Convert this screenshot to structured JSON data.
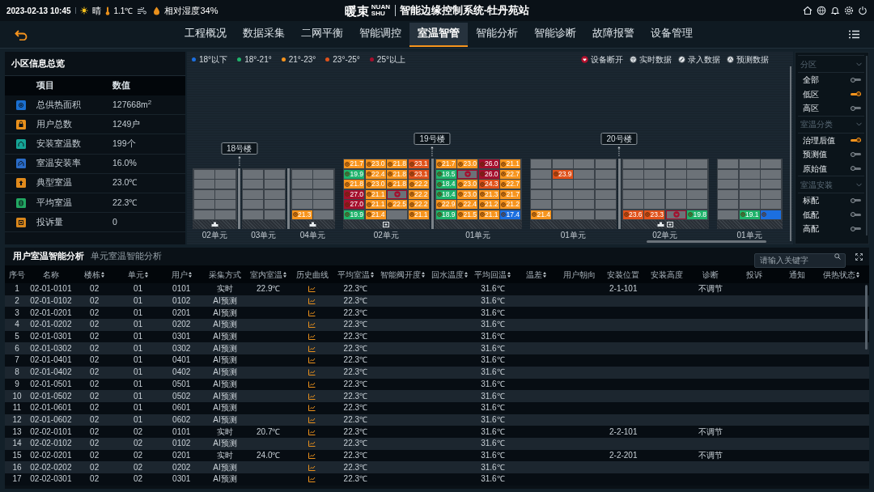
{
  "header": {
    "date_time": "2023-02-13 10:45",
    "weather": "晴",
    "temperature": "1.1℃",
    "humidity": "相对湿度34%",
    "logo": "暖束",
    "logo_sub": "NUAN SHU",
    "title": "智能边缘控制系统-牡丹苑站"
  },
  "nav": [
    {
      "label": "工程概况",
      "selected": false
    },
    {
      "label": "数据采集",
      "selected": false
    },
    {
      "label": "二网平衡",
      "selected": false
    },
    {
      "label": "智能调控",
      "selected": false
    },
    {
      "label": "室温智管",
      "selected": true
    },
    {
      "label": "智能分析",
      "selected": false
    },
    {
      "label": "智能诊断",
      "selected": false
    },
    {
      "label": "故障报警",
      "selected": false
    },
    {
      "label": "设备管理",
      "selected": false
    }
  ],
  "overview": {
    "title": "小区信息总览",
    "columns": [
      "项目",
      "数值"
    ],
    "rows": [
      {
        "label": "总供热面积",
        "value": "127668m$^{2}$",
        "color": "#1a6fd0"
      },
      {
        "label": "用户总数",
        "value": "1249户",
        "color": "#e8901c"
      },
      {
        "label": "安装室温数",
        "value": "199个",
        "color": "#16a596"
      },
      {
        "label": "室温安装率",
        "value": "16.0%",
        "color": "#2a6cc8"
      },
      {
        "label": "典型室温",
        "value": "23.0℃",
        "color": "#e08a1c"
      },
      {
        "label": "平均室温",
        "value": "22.3℃",
        "color": "#22a862"
      },
      {
        "label": "投诉量",
        "value": "0",
        "color": "#d8861c"
      }
    ]
  },
  "legend": {
    "temperature": [
      {
        "label": "18°以下",
        "color": "#1c6fe0"
      },
      {
        "label": "18°-21°",
        "color": "#1fb36b"
      },
      {
        "label": "21°-23°",
        "color": "#f7941d"
      },
      {
        "label": "23°-25°",
        "color": "#e0521b"
      },
      {
        "label": "25°以上",
        "color": "#a50f2d"
      }
    ],
    "data_source": [
      {
        "label": "设备断开",
        "kind": "offline"
      },
      {
        "label": "实时数据",
        "kind": "realtime"
      },
      {
        "label": "录入数据",
        "kind": "input"
      },
      {
        "label": "预测数据",
        "kind": "predicted"
      }
    ]
  },
  "buildings": [
    {
      "name": "18号楼",
      "units": [
        {
          "label": "02单元",
          "devices": [
            {
              "kind": "valve"
            }
          ],
          "rows": [
            [
              {
                "kind": "vacant"
              },
              {
                "kind": "vacant"
              }
            ],
            [
              {
                "kind": "vacant"
              },
              {
                "kind": "vacant"
              }
            ],
            [
              {
                "kind": "vacant"
              },
              {
                "kind": "vacant"
              }
            ],
            [
              {
                "kind": "vacant"
              },
              {
                "kind": "vacant"
              }
            ],
            [
              {
                "kind": "vacant"
              },
              {
                "kind": "vacant"
              }
            ]
          ]
        },
        {
          "label": "03单元",
          "rows": [
            [
              {
                "kind": "vacant"
              },
              {
                "kind": "vacant"
              }
            ],
            [
              {
                "kind": "vacant"
              },
              {
                "kind": "vacant"
              }
            ],
            [
              {
                "kind": "vacant"
              },
              {
                "kind": "vacant"
              }
            ],
            [
              {
                "kind": "vacant"
              },
              {
                "kind": "vacant"
              }
            ],
            [
              {
                "kind": "vacant"
              },
              {
                "kind": "vacant"
              }
            ]
          ]
        },
        {
          "label": "04单元",
          "devices": [
            {
              "kind": "valve"
            }
          ],
          "rows": [
            [
              {
                "kind": "vacant"
              },
              {
                "kind": "vacant"
              }
            ],
            [
              {
                "kind": "vacant"
              },
              {
                "kind": "vacant"
              }
            ],
            [
              {
                "kind": "vacant"
              },
              {
                "kind": "vacant"
              }
            ],
            [
              {
                "kind": "vacant"
              },
              {
                "kind": "vacant"
              }
            ],
            [
              {
                "kind": "realtime",
                "temp": "21.3",
                "color": "#f7941d"
              },
              {
                "kind": "vacant"
              }
            ]
          ]
        }
      ]
    },
    {
      "name": "19号楼",
      "units": [
        {
          "label": "02单元",
          "devices": [
            {
              "kind": "meter"
            }
          ],
          "rows": [
            [
              {
                "kind": "realtime",
                "temp": "21.7",
                "color": "#f7941d"
              },
              {
                "kind": "predicted",
                "temp": "23.0",
                "color": "#f7941d"
              },
              {
                "kind": "realtime",
                "temp": "21.8",
                "color": "#f7941d"
              },
              {
                "kind": "realtime",
                "temp": "23.1",
                "color": "#e0521b"
              }
            ],
            [
              {
                "kind": "realtime",
                "temp": "19.9",
                "color": "#1fb36b"
              },
              {
                "kind": "realtime",
                "temp": "22.4",
                "color": "#f7941d"
              },
              {
                "kind": "predicted",
                "temp": "21.8",
                "color": "#f7941d"
              },
              {
                "kind": "predicted",
                "temp": "23.1",
                "color": "#e0521b"
              }
            ],
            [
              {
                "kind": "realtime",
                "temp": "21.8",
                "color": "#f7941d"
              },
              {
                "kind": "realtime",
                "temp": "23.0",
                "color": "#f7941d"
              },
              {
                "kind": "predicted",
                "temp": "21.8",
                "color": "#f7941d"
              },
              {
                "kind": "realtime",
                "temp": "22.2",
                "color": "#f7941d"
              }
            ],
            [
              {
                "kind": "realtime",
                "temp": "27.0",
                "color": "#a50f2d"
              },
              {
                "kind": "realtime",
                "temp": "21.1",
                "color": "#f7941d"
              },
              {
                "kind": "offline",
                "color": "#a50f2d"
              },
              {
                "kind": "predicted",
                "temp": "22.2",
                "color": "#f7941d"
              }
            ],
            [
              {
                "kind": "realtime",
                "temp": "27.0",
                "color": "#a50f2d"
              },
              {
                "kind": "realtime",
                "temp": "21.1",
                "color": "#f7941d"
              },
              {
                "kind": "realtime",
                "temp": "22.5",
                "color": "#f7941d"
              },
              {
                "kind": "realtime",
                "temp": "22.2",
                "color": "#f7941d"
              }
            ],
            [
              {
                "kind": "realtime",
                "temp": "19.9",
                "color": "#1fb36b"
              },
              {
                "kind": "realtime",
                "temp": "21.4",
                "color": "#f7941d"
              },
              {
                "kind": "vacant"
              },
              {
                "kind": "predicted",
                "temp": "21.1",
                "color": "#f7941d"
              }
            ]
          ]
        },
        {
          "label": "01单元",
          "rows": [
            [
              {
                "kind": "realtime",
                "temp": "21.7",
                "color": "#f7941d"
              },
              {
                "kind": "predicted",
                "temp": "23.0",
                "color": "#f7941d"
              },
              {
                "kind": "realtime",
                "temp": "26.0",
                "color": "#a50f2d"
              },
              {
                "kind": "realtime",
                "temp": "21.1",
                "color": "#f7941d"
              }
            ],
            [
              {
                "kind": "realtime",
                "temp": "18.5",
                "color": "#1fb36b"
              },
              {
                "kind": "offline",
                "color": "#a50f2d"
              },
              {
                "kind": "realtime",
                "temp": "26.0",
                "color": "#a50f2d"
              },
              {
                "kind": "predicted",
                "temp": "22.7",
                "color": "#f7941d"
              }
            ],
            [
              {
                "kind": "realtime",
                "temp": "18.4",
                "color": "#1fb36b"
              },
              {
                "kind": "realtime",
                "temp": "23.0",
                "color": "#f7941d"
              },
              {
                "kind": "realtime",
                "temp": "24.3",
                "color": "#e0521b"
              },
              {
                "kind": "predicted",
                "temp": "22.7",
                "color": "#f7941d"
              }
            ],
            [
              {
                "kind": "predicted",
                "temp": "18.4",
                "color": "#1fb36b"
              },
              {
                "kind": "realtime",
                "temp": "23.0",
                "color": "#f7941d"
              },
              {
                "kind": "realtime",
                "temp": "21.3",
                "color": "#f7941d"
              },
              {
                "kind": "realtime",
                "temp": "21.7",
                "color": "#f7941d"
              }
            ],
            [
              {
                "kind": "realtime",
                "temp": "22.9",
                "color": "#f7941d"
              },
              {
                "kind": "realtime",
                "temp": "22.4",
                "color": "#f7941d"
              },
              {
                "kind": "realtime",
                "temp": "21.2",
                "color": "#f7941d"
              },
              {
                "kind": "realtime",
                "temp": "21.2",
                "color": "#f7941d"
              }
            ],
            [
              {
                "kind": "realtime",
                "temp": "18.9",
                "color": "#1fb36b"
              },
              {
                "kind": "realtime",
                "temp": "21.5",
                "color": "#f7941d"
              },
              {
                "kind": "realtime",
                "temp": "21.1",
                "color": "#f7941d"
              },
              {
                "kind": "realtime",
                "temp": "17.4",
                "color": "#1c6fe0"
              }
            ]
          ]
        }
      ]
    },
    {
      "name": "20号楼",
      "units": [
        {
          "label": "01单元",
          "rows": [
            [
              {
                "kind": "vacant"
              },
              {
                "kind": "vacant"
              },
              {
                "kind": "vacant"
              },
              {
                "kind": "vacant"
              }
            ],
            [
              {
                "kind": "vacant"
              },
              {
                "kind": "realtime",
                "temp": "23.9",
                "color": "#e0521b"
              },
              {
                "kind": "vacant"
              },
              {
                "kind": "vacant"
              }
            ],
            [
              {
                "kind": "vacant"
              },
              {
                "kind": "vacant"
              },
              {
                "kind": "vacant"
              },
              {
                "kind": "vacant"
              }
            ],
            [
              {
                "kind": "vacant"
              },
              {
                "kind": "vacant"
              },
              {
                "kind": "vacant"
              },
              {
                "kind": "vacant"
              }
            ],
            [
              {
                "kind": "vacant"
              },
              {
                "kind": "vacant"
              },
              {
                "kind": "vacant"
              },
              {
                "kind": "vacant"
              }
            ],
            [
              {
                "kind": "realtime",
                "temp": "21.4",
                "color": "#f7941d"
              },
              {
                "kind": "vacant"
              },
              {
                "kind": "vacant"
              },
              {
                "kind": "vacant"
              }
            ]
          ]
        },
        {
          "label": "02单元",
          "devices": [
            {
              "kind": "valve"
            },
            {
              "kind": "meter"
            }
          ],
          "rows": [
            [
              {
                "kind": "vacant"
              },
              {
                "kind": "vacant"
              },
              {
                "kind": "vacant"
              },
              {
                "kind": "vacant"
              }
            ],
            [
              {
                "kind": "vacant"
              },
              {
                "kind": "vacant"
              },
              {
                "kind": "vacant"
              },
              {
                "kind": "vacant"
              }
            ],
            [
              {
                "kind": "vacant"
              },
              {
                "kind": "vacant"
              },
              {
                "kind": "vacant"
              },
              {
                "kind": "vacant"
              }
            ],
            [
              {
                "kind": "vacant"
              },
              {
                "kind": "vacant"
              },
              {
                "kind": "vacant"
              },
              {
                "kind": "vacant"
              }
            ],
            [
              {
                "kind": "vacant"
              },
              {
                "kind": "vacant"
              },
              {
                "kind": "vacant"
              },
              {
                "kind": "vacant"
              }
            ],
            [
              {
                "kind": "realtime",
                "temp": "23.6",
                "color": "#e0521b"
              },
              {
                "kind": "realtime",
                "temp": "23.3",
                "color": "#e0521b"
              },
              {
                "kind": "offline",
                "color": "#a50f2d"
              },
              {
                "kind": "realtime",
                "temp": "19.8",
                "color": "#1fb36b"
              }
            ]
          ]
        }
      ]
    },
    {
      "units": [
        {
          "label": "01单元",
          "rows": [
            [
              {
                "kind": "vacant"
              },
              {
                "kind": "vacant"
              },
              {
                "kind": "vacant"
              }
            ],
            [
              {
                "kind": "vacant"
              },
              {
                "kind": "vacant"
              },
              {
                "kind": "vacant"
              }
            ],
            [
              {
                "kind": "vacant"
              },
              {
                "kind": "vacant"
              },
              {
                "kind": "vacant"
              }
            ],
            [
              {
                "kind": "vacant"
              },
              {
                "kind": "vacant"
              },
              {
                "kind": "vacant"
              }
            ],
            [
              {
                "kind": "vacant"
              },
              {
                "kind": "vacant"
              },
              {
                "kind": "vacant"
              }
            ],
            [
              {
                "kind": "vacant"
              },
              {
                "kind": "realtime",
                "temp": "19.1",
                "color": "#1fb36b"
              },
              {
                "kind": "realtime",
                "color": "#1c6fe0"
              }
            ]
          ]
        }
      ]
    }
  ],
  "filters": [
    {
      "title": "分区",
      "expanded": true,
      "items": [
        {
          "label": "全部",
          "on": false
        },
        {
          "label": "低区",
          "on": true
        },
        {
          "label": "高区",
          "on": false
        }
      ]
    },
    {
      "title": "室温分类",
      "expanded": true,
      "items": [
        {
          "label": "治理后值",
          "on": true
        },
        {
          "label": "预测值",
          "on": false
        },
        {
          "label": "原始值",
          "on": false
        }
      ]
    },
    {
      "title": "室温安装",
      "expanded": true,
      "items": [
        {
          "label": "标配",
          "on": false
        },
        {
          "label": "低配",
          "on": false
        },
        {
          "label": "高配",
          "on": false
        }
      ]
    }
  ],
  "table": {
    "tabs": [
      {
        "label": "用户室温智能分析",
        "selected": true
      },
      {
        "label": "单元室温智能分析",
        "selected": false
      }
    ],
    "search": {
      "placeholder": "请输入关键字"
    },
    "columns": [
      {
        "label": "序号",
        "sortable": false
      },
      {
        "label": "名称",
        "sortable": false
      },
      {
        "label": "楼栋",
        "sortable": true
      },
      {
        "label": "单元",
        "sortable": true
      },
      {
        "label": "用户",
        "sortable": true
      },
      {
        "label": "采集方式",
        "sortable": false
      },
      {
        "label": "室内室温",
        "sortable": true
      },
      {
        "label": "历史曲线",
        "kind": "chart",
        "sortable": false
      },
      {
        "label": "平均室温",
        "sortable": true
      },
      {
        "label": "智能阀开度",
        "sortable": true
      },
      {
        "label": "回水温度",
        "sortable": true
      },
      {
        "label": "平均回温",
        "sortable": true
      },
      {
        "label": "温差",
        "sortable": true
      },
      {
        "label": "用户朝向",
        "sortable": false
      },
      {
        "label": "安装位置",
        "sortable": false
      },
      {
        "label": "安装高度",
        "sortable": false
      },
      {
        "label": "诊断",
        "sortable": false
      },
      {
        "label": "投诉",
        "sortable": false
      },
      {
        "label": "通知",
        "sortable": false
      },
      {
        "label": "供热状态",
        "sortable": true
      }
    ],
    "rows": [
      [
        "1",
        "02-01-0101",
        "02",
        "01",
        "0101",
        "实时",
        "22.9℃",
        null,
        "22.3℃",
        null,
        null,
        "31.6℃",
        null,
        null,
        "2-1-101",
        null,
        "不调节",
        null,
        null,
        null
      ],
      [
        "2",
        "02-01-0102",
        "02",
        "01",
        "0102",
        "AI预测",
        null,
        null,
        "22.3℃",
        null,
        null,
        "31.6℃",
        null,
        null,
        null,
        null,
        null,
        null,
        null,
        null
      ],
      [
        "3",
        "02-01-0201",
        "02",
        "01",
        "0201",
        "AI预测",
        null,
        null,
        "22.3℃",
        null,
        null,
        "31.6℃",
        null,
        null,
        null,
        null,
        null,
        null,
        null,
        null
      ],
      [
        "4",
        "02-01-0202",
        "02",
        "01",
        "0202",
        "AI预测",
        null,
        null,
        "22.3℃",
        null,
        null,
        "31.6℃",
        null,
        null,
        null,
        null,
        null,
        null,
        null,
        null
      ],
      [
        "5",
        "02-01-0301",
        "02",
        "01",
        "0301",
        "AI预测",
        null,
        null,
        "22.3℃",
        null,
        null,
        "31.6℃",
        null,
        null,
        null,
        null,
        null,
        null,
        null,
        null
      ],
      [
        "6",
        "02-01-0302",
        "02",
        "01",
        "0302",
        "AI预测",
        null,
        null,
        "22.3℃",
        null,
        null,
        "31.6℃",
        null,
        null,
        null,
        null,
        null,
        null,
        null,
        null
      ],
      [
        "7",
        "02-01-0401",
        "02",
        "01",
        "0401",
        "AI预测",
        null,
        null,
        "22.3℃",
        null,
        null,
        "31.6℃",
        null,
        null,
        null,
        null,
        null,
        null,
        null,
        null
      ],
      [
        "8",
        "02-01-0402",
        "02",
        "01",
        "0402",
        "AI预测",
        null,
        null,
        "22.3℃",
        null,
        null,
        "31.6℃",
        null,
        null,
        null,
        null,
        null,
        null,
        null,
        null
      ],
      [
        "9",
        "02-01-0501",
        "02",
        "01",
        "0501",
        "AI预测",
        null,
        null,
        "22.3℃",
        null,
        null,
        "31.6℃",
        null,
        null,
        null,
        null,
        null,
        null,
        null,
        null
      ],
      [
        "10",
        "02-01-0502",
        "02",
        "01",
        "0502",
        "AI预测",
        null,
        null,
        "22.3℃",
        null,
        null,
        "31.6℃",
        null,
        null,
        null,
        null,
        null,
        null,
        null,
        null
      ],
      [
        "11",
        "02-01-0601",
        "02",
        "01",
        "0601",
        "AI预测",
        null,
        null,
        "22.3℃",
        null,
        null,
        "31.6℃",
        null,
        null,
        null,
        null,
        null,
        null,
        null,
        null
      ],
      [
        "12",
        "02-01-0602",
        "02",
        "01",
        "0602",
        "AI预测",
        null,
        null,
        "22.3℃",
        null,
        null,
        "31.6℃",
        null,
        null,
        null,
        null,
        null,
        null,
        null,
        null
      ],
      [
        "13",
        "02-02-0101",
        "02",
        "02",
        "0101",
        "实时",
        "20.7℃",
        null,
        "22.3℃",
        null,
        null,
        "31.6℃",
        null,
        null,
        "2-2-101",
        null,
        "不调节",
        null,
        null,
        null
      ],
      [
        "14",
        "02-02-0102",
        "02",
        "02",
        "0102",
        "AI预测",
        null,
        null,
        "22.3℃",
        null,
        null,
        "31.6℃",
        null,
        null,
        null,
        null,
        null,
        null,
        null,
        null
      ],
      [
        "15",
        "02-02-0201",
        "02",
        "02",
        "0201",
        "实时",
        "24.0℃",
        null,
        "22.3℃",
        null,
        null,
        "31.6℃",
        null,
        null,
        "2-2-201",
        null,
        "不调节",
        null,
        null,
        null
      ],
      [
        "16",
        "02-02-0202",
        "02",
        "02",
        "0202",
        "AI预测",
        null,
        null,
        "22.3℃",
        null,
        null,
        "31.6℃",
        null,
        null,
        null,
        null,
        null,
        null,
        null,
        null
      ],
      [
        "17",
        "02-02-0301",
        "02",
        "02",
        "0301",
        "AI预测",
        null,
        null,
        "22.3℃",
        null,
        null,
        "31.6℃",
        null,
        null,
        null,
        null,
        null,
        null,
        null,
        null
      ]
    ]
  }
}
